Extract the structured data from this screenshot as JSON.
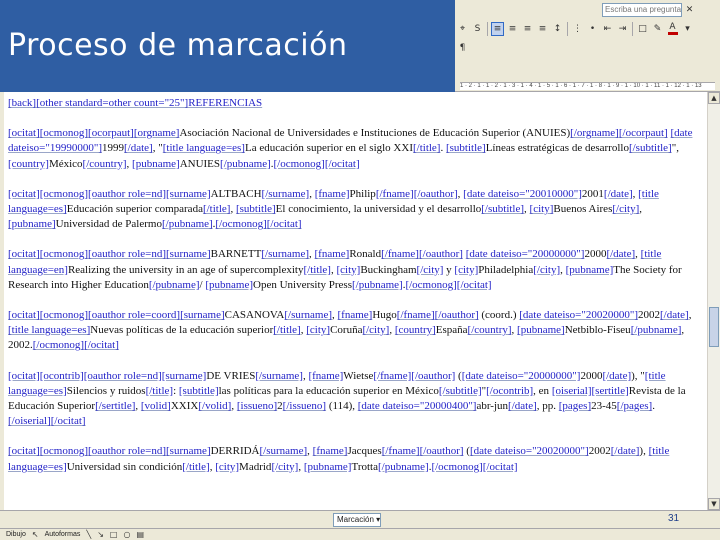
{
  "slide": {
    "title": "Proceso de marcación",
    "number": "31"
  },
  "toolbar": {
    "ask_placeholder": "Escriba una pregunta",
    "ruler_text": "1 · 2 · 1 · 1 · 2 · 1 · 3 · 1 · 4 · 1 · 5 · 1 · 6 · 1 · 7 · 1 · 8 · 1 · 9 · 1 · 10 · 1 · 11 · 1 · 12 · 1 · 13",
    "font_color": "#c00000"
  },
  "status": {
    "markup_label": "Marcación",
    "draw_label": "Dibujo",
    "autoshapes_label": "Autoformas"
  },
  "document": {
    "header_line": "[back][other standard=other count=\"25\"]REFERENCIAS",
    "references": [
      {
        "p1": "[ocitat][ocmonog][ocorpaut][orgname]Asociación Nacional de Universidades e Instituciones de Educación Superior (ANUIES)[/orgname][/ocorpaut] [date dateiso=\"19990000\"]1999[/date], \"[title language=es]La educación superior en el siglo XXI[/title]. [subtitle]Líneas estratégicas de desarrollo[/subtitle]\", [country]México[/country], [pubname]ANUIES[/pubname].[/ocmonog][/ocitat]"
      },
      {
        "p1": "[ocitat][ocmonog][oauthor role=nd][surname]ALTBACH[/surname], [fname]Philip[/fname][/oauthor], [date dateiso=\"20010000\"]2001[/date], [title language=es]Educación superior comparada[/title], [subtitle]El conocimiento, la universidad y el desarrollo[/subtitle], [city]Buenos Aires[/city], [pubname]Universidad de Palermo[/pubname].[/ocmonog][/ocitat]"
      },
      {
        "p1": "[ocitat][ocmonog][oauthor role=nd][surname]BARNETT[/surname], [fname]Ronald[/fname][/oauthor] [date dateiso=\"20000000\"]2000[/date], [title language=en]Realizing the university in an age of supercomplexity[/title], [city]Buckingham[/city] y [city]Philadelphia[/city], [pubname]The Society for Research into Higher Education[/pubname]/ [pubname]Open University Press[/pubname].[/ocmonog][/ocitat]"
      },
      {
        "p1": "[ocitat][ocmonog][oauthor role=coord][surname]CASANOVA[/surname], [fname]Hugo[/fname][/oauthor] (coord.) [date dateiso=\"20020000\"]2002[/date], [title language=es]Nuevas políticas de la educación superior[/title], [city]Coruña[/city], [country]España[/country], [pubname]Netbiblo-Fiseu[/pubname], 2002.[/ocmonog][/ocitat]"
      },
      {
        "p1": "[ocitat][ocontrib][oauthor role=nd][surname]DE VRIES[/surname], [fname]Wietse[/fname][/oauthor] ([date dateiso=\"20000000\"]2000[/date]), \"[title language=es]Silencios y ruidos[/title]: [subtitle]las políticas para la educación superior en México[/subtitle]\"[/ocontrib], en [oiserial][sertitle]Revista de la Educación Superior[/sertitle], [volid]XXIX[/volid], [issueno]2[/issueno] (114), [date dateiso=\"20000400\"]abr-jun[/date], pp. [pages]23-45[/pages].[/oiserial][/ocitat]"
      },
      {
        "p1": "[ocitat][ocmonog][oauthor role=nd][surname]DERRIDÁ[/surname], [fname]Jacques[/fname][/oauthor] ([date dateiso=\"20020000\"]2002[/date]), [title language=es]Universidad sin condición[/title], [city]Madrid[/city], [pubname]Trotta[/pubname].[/ocmonog][/ocitat]"
      }
    ]
  }
}
